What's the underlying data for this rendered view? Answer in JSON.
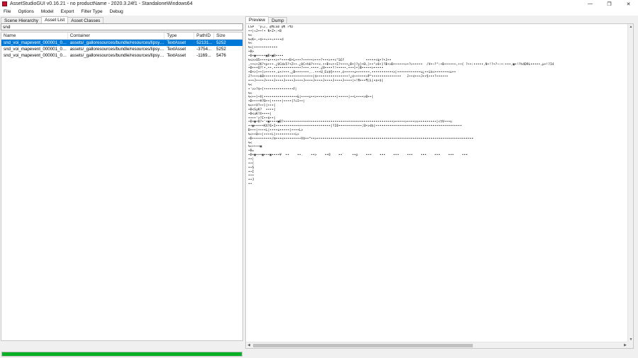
{
  "window": {
    "title": "AssetStudioGUI v0.16.21 - no productName - 2020.3.24f1 - StandaloneWindows64",
    "minimize": "—",
    "maximize": "❐",
    "close": "✕"
  },
  "menu": [
    "File",
    "Options",
    "Model",
    "Export",
    "Filter Type",
    "Debug"
  ],
  "left_tabs": [
    "Scene Hierarchy",
    "Asset List",
    "Asset Classes"
  ],
  "filter": {
    "value": "snd"
  },
  "columns": [
    "Name",
    "Container",
    "Type",
    "PathID",
    "Size"
  ],
  "rows": [
    {
      "name": "snd_voi_mapevent_000001_0001",
      "container": "assets/_galloresources/bundle/resources/lipsync/...",
      "type": "TextAsset",
      "pathid": "52131...",
      "size": "5252"
    },
    {
      "name": "snd_voi_mapevent_000001_0003",
      "container": "assets/_galloresources/bundle/resources/lipsync/...",
      "type": "TextAsset",
      "pathid": "-3754...",
      "size": "5252"
    },
    {
      "name": "snd_voi_mapevent_000001_0002",
      "container": "assets/_galloresources/bundle/resources/lipsync/...",
      "type": "TextAsset",
      "pathid": "-1169...",
      "size": "5476"
    }
  ],
  "progress_percent": 100,
  "progress_color": "#06b025",
  "right_tabs": [
    "Preview",
    "Dump"
  ],
  "preview_lines": [
    "LSP `‘ý↘↓, @¶LSD @¶ ↑¶z",
    "••|«2••!• N•Z•;•B",
    "%<",
    "%<K•,•$••«••«••••d",
    "%<",
    "%<|••••••••••••",
    "•B>",
    "•B•▣•••••▣B•▣B••••",
    "%<>>O5••••u•••>•*••••B•L•••?•••••>•••?•••>••<\"16?           •••••<q•?•J••",
    ",••<•JK?•p•••.¿UCdx5?•Z••.¿UC•hU?•••<.••B•<••I?••••¿B•}?y}•B,}••°>O•}?B•>B••••••>•?>•••••  /V•~?\":•B••••••,••{ ?••:•••••,N•!?•?~:•:•••,▣•!?h4D9L•••••,µ•!?I4",
    "•B•••Q?!•,••,••••••••••••••?•••.••••.¿B••••?!•••••,•••}•}B•••••>•••••",
    "•B•>[••]>•••••,u•r•••,¿B•••••••,..•••U_Ex$§••••,¢•••••u•••••••,•••••••••••>|••••••••••••u¿••Lk<•••••••<u••",
    "J?•••>bB••••••••>••••••••••••••••|$••••••••••••••••!¿¢••••••>P^•••••••••••••••   J••¢•••J••§•••?••••••",
    "•••J••••J••••J••••J••••J••••J••••J••••J••••J••••J••••|•!M•••¶|L|•a•$|",
    "%<",
    "•'>>?$•[•••••••••••••••F|",
    "%<",
    "%<••}•V|•••••••••••••••••&|••••u••>••••>•••••|•••••|••L••••>B••|",
    "•B••••¥?B••|•••••|••••{?cI••|",
    "%<••V?••}|•••|",
    "•B<SyK?  ••••|",
    "•B<uK?X••••|",
    "••••'>?I••$••|",
    "•B•▣•B?•'•▣••••▣B?••••••••••••••••••••••••••••••••••••••••••••••••••••••••>•••••>••••>>•••••••••|<tV•••u",
    "••▣•••••KX?6•I••••••••••••••••••••••••••••|?IO••••••••••••;B•>d$|••••••••••••••••••••••••••••••••••••••••••••",
    "B•••|••••L|••••u•••••|••••L>",
    "%<••B••|••••L|••••••••••L>",
    "•B••••••••••/m•••<•••••••••V$••*••>••••••••••••••••••••••••••••••••••••••••••••••••••••••••••••••••••••••••••••••••",
    "%<",
    "%<••••▣",
    "•B=",
    "•B•▣•••▣•••▣••••¥  ••    ••.    ••>    ••O    ••`    ••p    •••    •••    •••    •••    •••    •••    •••    •••",
    "••|",
    "••{",
    "••§",
    "••I",
    "•••",
    "••J",
    "••"
  ]
}
